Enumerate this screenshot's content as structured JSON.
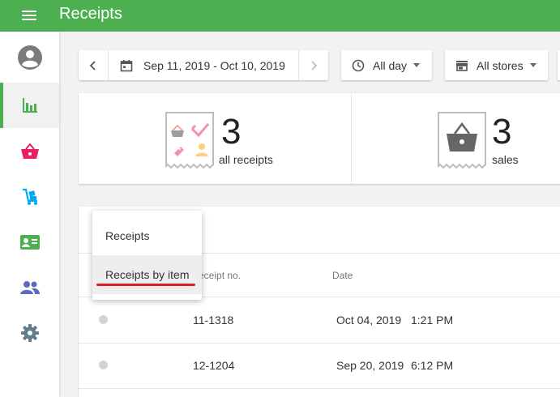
{
  "app_title": "Receipts",
  "sidebar": {
    "items": [
      {
        "icon": "account-icon",
        "active": false
      },
      {
        "icon": "reports-icon",
        "active": true
      },
      {
        "icon": "basket-icon",
        "active": false
      },
      {
        "icon": "inventory-icon",
        "active": false
      },
      {
        "icon": "employee-card-icon",
        "active": false
      },
      {
        "icon": "customers-icon",
        "active": false
      },
      {
        "icon": "settings-icon",
        "active": false
      }
    ]
  },
  "filters": {
    "date_range": "Sep 11, 2019 - Oct 10, 2019",
    "time": "All day",
    "stores": "All stores"
  },
  "summary": {
    "all_receipts": {
      "value": "3",
      "label": "all receipts"
    },
    "sales": {
      "value": "3",
      "label": "sales"
    }
  },
  "table": {
    "headers": {
      "receipt_no": "eceipt no.",
      "date": "Date"
    },
    "rows": [
      {
        "receipt_no": "11-1318",
        "date": "Oct 04, 2019",
        "time": "1:21 PM"
      },
      {
        "receipt_no": "12-1204",
        "date": "Sep 20, 2019",
        "time": "6:12 PM"
      }
    ]
  },
  "view_menu": {
    "items": [
      {
        "label": "Receipts"
      },
      {
        "label": "Receipts by item"
      }
    ],
    "highlighted": "Receipts by item"
  },
  "colors": {
    "app_bar": "#4caf50",
    "active_indicator": "#4caf50",
    "annotation_underline": "#e01b24",
    "basket_icon": "#e91e63",
    "inventory_icon": "#03a9f4",
    "employee_icon": "#4caf50",
    "customers_icon": "#5c6bc0",
    "settings_icon": "#607d8b"
  }
}
